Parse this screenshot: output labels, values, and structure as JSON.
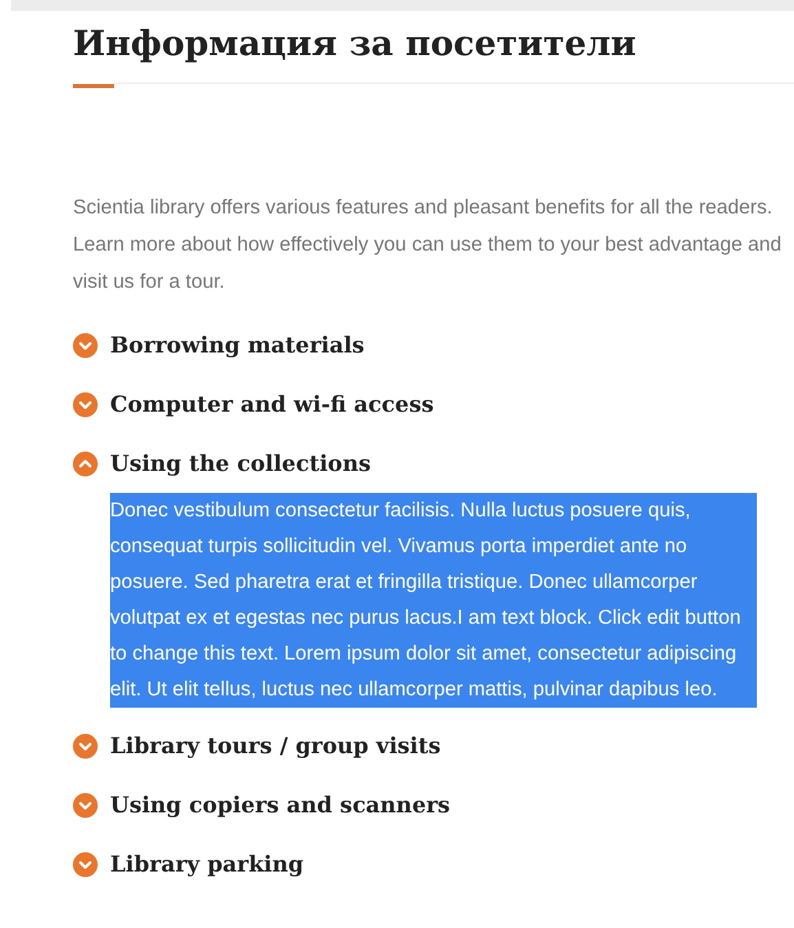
{
  "heading": "Информация за посетители",
  "intro": "Scientia library offers various features and pleasant benefits for all the readers. Learn more about how effectively you can use them to your best advantage and visit us for a tour.",
  "accordion": [
    {
      "title": "Borrowing materials",
      "expanded": false
    },
    {
      "title": "Computer and wi-fi access",
      "expanded": false
    },
    {
      "title": "Using the collections",
      "expanded": true,
      "body": "Donec vestibulum consectetur facilisis. Nulla luctus posuere quis, consequat turpis sollicitudin vel. Vivamus porta imperdiet ante no posuere. Sed pharetra erat et fringilla tristique. Donec ullamcorper volutpat ex et egestas nec purus lacus.I am text block. Click edit button to change this text. Lorem ipsum dolor sit amet, consectetur adipiscing elit. Ut elit tellus, luctus nec ullamcorper mattis, pulvinar dapibus leo.",
      "body_selected": true
    },
    {
      "title": "Library tours / group visits",
      "expanded": false
    },
    {
      "title": "Using copiers and scanners",
      "expanded": false
    },
    {
      "title": "Library parking",
      "expanded": false
    }
  ]
}
